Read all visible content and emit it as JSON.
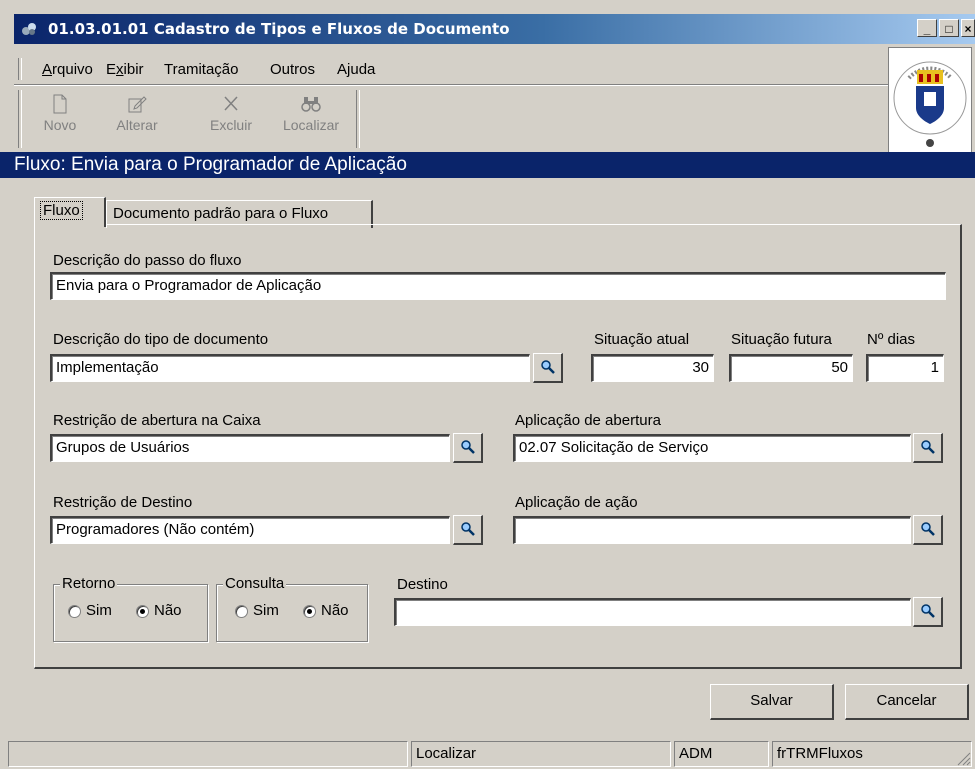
{
  "window": {
    "title": "01.03.01.01 Cadastro de Tipos e Fluxos de Documento",
    "controls": {
      "minimize": "_",
      "maximize": "□",
      "close": "×"
    }
  },
  "menu": [
    {
      "label": "Arquivo",
      "access": "A"
    },
    {
      "label": "Exibir",
      "access": "x"
    },
    {
      "label": "Tramitação",
      "access": ""
    },
    {
      "label": "Outros",
      "access": ""
    },
    {
      "label": "Ajuda",
      "access": "j"
    }
  ],
  "toolbar": [
    {
      "label": "Novo",
      "icon": "new-document-icon",
      "enabled": false
    },
    {
      "label": "Alterar",
      "icon": "edit-icon",
      "enabled": false
    },
    {
      "label": "Excluir",
      "icon": "delete-x-icon",
      "enabled": false
    },
    {
      "label": "Localizar",
      "icon": "binoculars-icon",
      "enabled": false
    }
  ],
  "header": {
    "text": "Fluxo: Envia para o Programador de Aplicação"
  },
  "tabs": [
    {
      "label": "Fluxo",
      "active": true
    },
    {
      "label": "Documento padrão para o Fluxo",
      "active": false
    }
  ],
  "form": {
    "descricao_passo": {
      "label": "Descrição do passo do fluxo",
      "value": "Envia para o Programador de Aplicação"
    },
    "descricao_tipo": {
      "label": "Descrição do tipo de documento",
      "value": "Implementação"
    },
    "situacao_atual": {
      "label": "Situação atual",
      "value": "30"
    },
    "situacao_futura": {
      "label": "Situação futura",
      "value": "50"
    },
    "num_dias": {
      "label": "Nº dias",
      "value": "1"
    },
    "restricao_abertura": {
      "label": "Restrição de abertura na Caixa",
      "value": "Grupos de Usuários"
    },
    "aplicacao_abertura": {
      "label": "Aplicação de abertura",
      "value": "02.07 Solicitação de Serviço"
    },
    "restricao_destino": {
      "label": "Restrição de Destino",
      "value": "Programadores (Não contém)"
    },
    "aplicacao_acao": {
      "label": "Aplicação de ação",
      "value": ""
    },
    "retorno": {
      "label": "Retorno",
      "options": [
        "Sim",
        "Não"
      ],
      "selected": "Não"
    },
    "consulta": {
      "label": "Consulta",
      "options": [
        "Sim",
        "Não"
      ],
      "selected": "Não"
    },
    "destino": {
      "label": "Destino",
      "value": ""
    }
  },
  "buttons": {
    "save": "Salvar",
    "cancel": "Cancelar"
  },
  "status": {
    "panel1": "",
    "panel2": "Localizar",
    "panel3": "ADM",
    "panel4": "frTRMFluxos"
  },
  "colors": {
    "titlebar": "#0a246a",
    "header": "#0a246a",
    "face": "#d4d0c8"
  }
}
